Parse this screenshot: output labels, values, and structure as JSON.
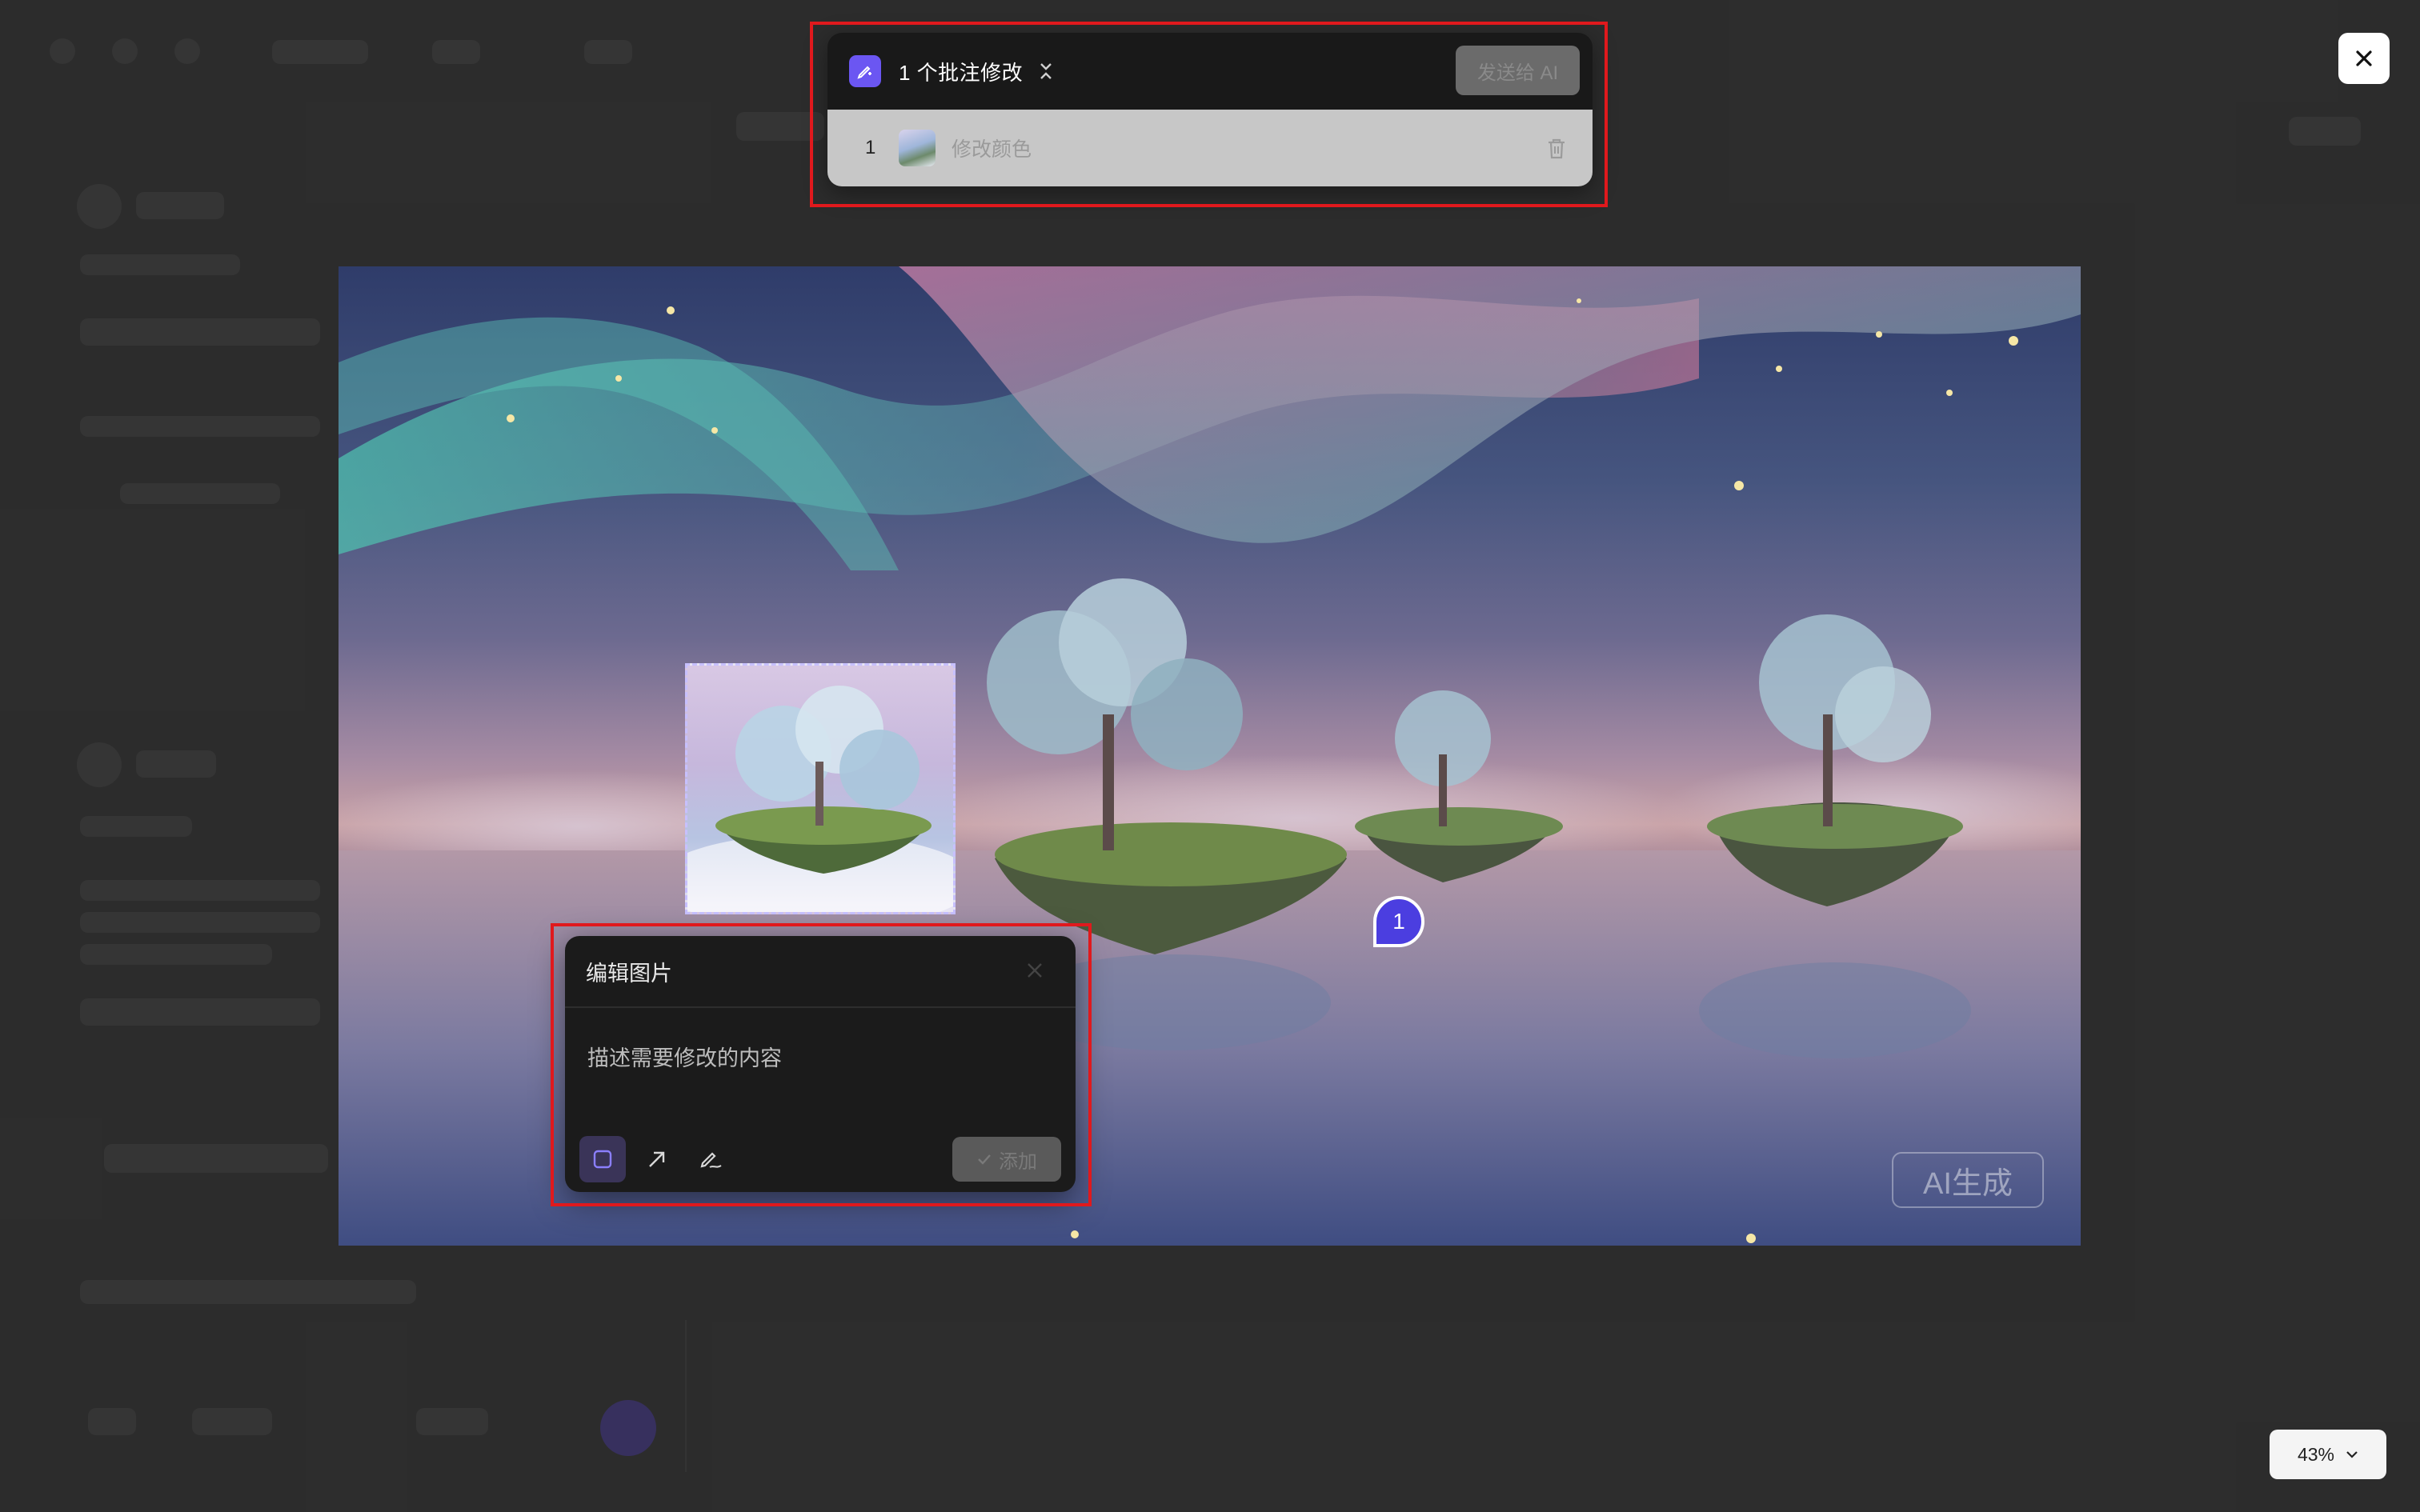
{
  "annotation_panel": {
    "title": "1 个批注修改",
    "send_button_label": "发送给 AI",
    "items": [
      {
        "index": "1",
        "text": "修改颜色"
      }
    ]
  },
  "edit_popover": {
    "title": "编辑图片",
    "placeholder": "描述需要修改的内容",
    "add_button_label": "添加",
    "tools": [
      "rectangle-tool-icon",
      "arrow-tool-icon",
      "pen-tool-icon"
    ]
  },
  "marker": {
    "number": "1"
  },
  "watermark": {
    "text": "AI生成"
  },
  "zoom": {
    "level": "43%"
  },
  "colors": {
    "accent": "#6b56f2",
    "highlight": "#e0191d",
    "marker": "#4b3ee0"
  }
}
